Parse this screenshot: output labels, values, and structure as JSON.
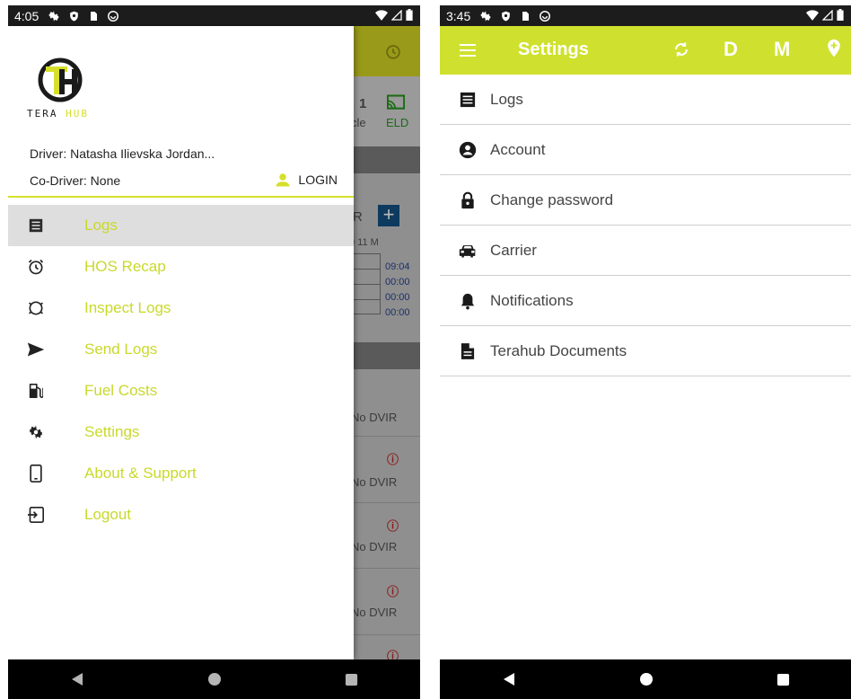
{
  "left_screen": {
    "status_time": "4:05",
    "background": {
      "vehicle_number": "1",
      "vehicle_label": "cle",
      "eld_label": "ELD",
      "r_letter": "R",
      "plus": "+",
      "time_header": "0 11 M",
      "times": [
        "09:04",
        "00:00",
        "00:00",
        "00:00"
      ],
      "dvir_rows": [
        "No DVIR",
        "No DVIR",
        "No DVIR",
        "No DVIR"
      ]
    },
    "drawer": {
      "logo_tera": "TERA ",
      "logo_hub": "HUB",
      "driver": "Driver: Natasha Ilievska Jordan...",
      "codriver": "Co-Driver: None",
      "login_label": "LOGIN",
      "menu": [
        {
          "label": "Logs",
          "icon": "list-icon",
          "active": true
        },
        {
          "label": "HOS Recap",
          "icon": "alarm-clock-icon",
          "active": false
        },
        {
          "label": "Inspect Logs",
          "icon": "inspect-icon",
          "active": false
        },
        {
          "label": "Send Logs",
          "icon": "send-icon",
          "active": false
        },
        {
          "label": "Fuel Costs",
          "icon": "fuel-icon",
          "active": false
        },
        {
          "label": "Settings",
          "icon": "gear-icon",
          "active": false
        },
        {
          "label": "About & Support",
          "icon": "phone-icon",
          "active": false
        },
        {
          "label": "Logout",
          "icon": "logout-icon",
          "active": false
        }
      ]
    }
  },
  "right_screen": {
    "status_time": "3:45",
    "toolbar": {
      "title": "Settings",
      "d_label": "D",
      "m_label": "M"
    },
    "settings": [
      {
        "label": "Logs",
        "icon": "list-icon"
      },
      {
        "label": "Account",
        "icon": "account-icon"
      },
      {
        "label": "Change password",
        "icon": "lock-icon"
      },
      {
        "label": "Carrier",
        "icon": "car-icon"
      },
      {
        "label": "Notifications",
        "icon": "bell-icon"
      },
      {
        "label": "Terahub Documents",
        "icon": "document-icon"
      }
    ]
  },
  "colors": {
    "accent": "#cfe12e",
    "menu_text": "#c9d92b",
    "statusbar": "#1c1c1c",
    "navbar": "#000000"
  }
}
